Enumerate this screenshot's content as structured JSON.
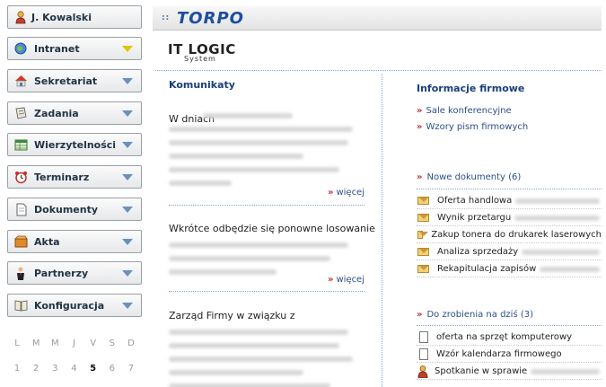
{
  "user": {
    "name": "J. Kowalski"
  },
  "menu": [
    {
      "label": "Intranet",
      "icon": "globe-icon",
      "active": true
    },
    {
      "label": "Sekretariat",
      "icon": "house-icon"
    },
    {
      "label": "Zadania",
      "icon": "notebook-icon"
    },
    {
      "label": "Wierzytelności",
      "icon": "spreadsheet-icon"
    },
    {
      "label": "Terminarz",
      "icon": "alarm-clock-icon"
    },
    {
      "label": "Dokumenty",
      "icon": "document-icon"
    },
    {
      "label": "Akta",
      "icon": "folder-box-icon"
    },
    {
      "label": "Partnerzy",
      "icon": "person-icon"
    },
    {
      "label": "Konfiguracja",
      "icon": "book-icon"
    }
  ],
  "calendar": {
    "weekdays": [
      "L",
      "M",
      "M",
      "J",
      "V",
      "S",
      "D"
    ],
    "days": [
      "1",
      "2",
      "3",
      "4",
      "5",
      "6",
      "7"
    ],
    "today": "5"
  },
  "header": {
    "brand": "TORPO",
    "dots": "::"
  },
  "logo": {
    "line1": "IT LOGIC",
    "line2": "System"
  },
  "announcements": {
    "title": "Komunikaty",
    "more_label": "więcej",
    "items": [
      {
        "title": "W dniach"
      },
      {
        "title": "Wkrótce odbędzie się ponowne losowanie"
      },
      {
        "title": "Zarząd  Firmy  w związku z"
      }
    ]
  },
  "company_info": {
    "title": "Informacje firmowe",
    "links": [
      "Sale konferencyjne",
      "Wzory pism firmowych"
    ]
  },
  "new_documents": {
    "title": "Nowe dokumenty (6)",
    "items": [
      "Oferta handlowa",
      "Wynik przetargu",
      "Zakup tonera do drukarek laserowych",
      "Analiza sprzedaży",
      "Rekapitulacja zapisów"
    ]
  },
  "todo_today": {
    "title": "Do zrobienia na dziś (3)",
    "items": [
      "oferta na sprzęt komputerowy",
      "Wzór kalendarza firmowego",
      "Spotkanie w sprawie"
    ]
  },
  "colors": {
    "accent": "#1e4ea0",
    "link": "#2c4f8a",
    "chevron": "#cc2a2a",
    "heading": "#1a3f7a"
  }
}
